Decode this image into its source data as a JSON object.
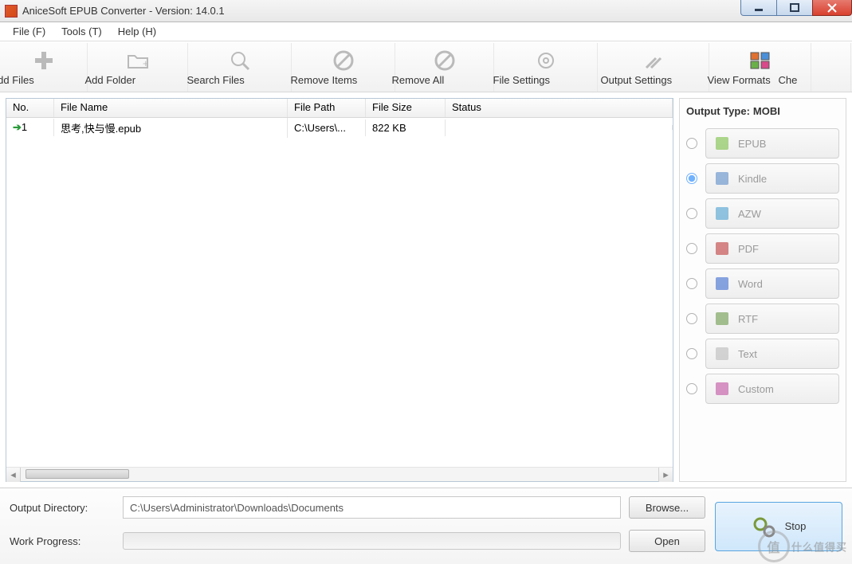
{
  "window": {
    "title": "AniceSoft EPUB Converter - Version: 14.0.1"
  },
  "menu": {
    "file": "File (F)",
    "tools": "Tools (T)",
    "help": "Help (H)"
  },
  "toolbar": {
    "add_files": "Add Files",
    "add_folder": "Add Folder",
    "search_files": "Search Files",
    "remove_items": "Remove Items",
    "remove_all": "Remove All",
    "file_settings": "File Settings",
    "output_settings": "Output Settings",
    "view_formats": "View Formats",
    "check": "Che"
  },
  "columns": {
    "no": "No.",
    "name": "File Name",
    "path": "File Path",
    "size": "File Size",
    "status": "Status"
  },
  "rows": [
    {
      "no": "1",
      "name": "思考,快与慢.epub",
      "path": "C:\\Users\\...",
      "size": "822 KB",
      "status": ""
    }
  ],
  "output": {
    "type_label": "Output Type:",
    "type_value": "MOBI",
    "formats": [
      "EPUB",
      "Kindle",
      "AZW",
      "PDF",
      "Word",
      "RTF",
      "Text",
      "Custom"
    ],
    "selected_index": 1
  },
  "bottom": {
    "outdir_label": "Output Directory:",
    "outdir_value": "C:\\Users\\Administrator\\Downloads\\Documents",
    "browse": "Browse...",
    "progress_label": "Work Progress:",
    "open": "Open",
    "stop": "Stop"
  },
  "watermark": {
    "badge": "值",
    "text": "什么值得买"
  }
}
